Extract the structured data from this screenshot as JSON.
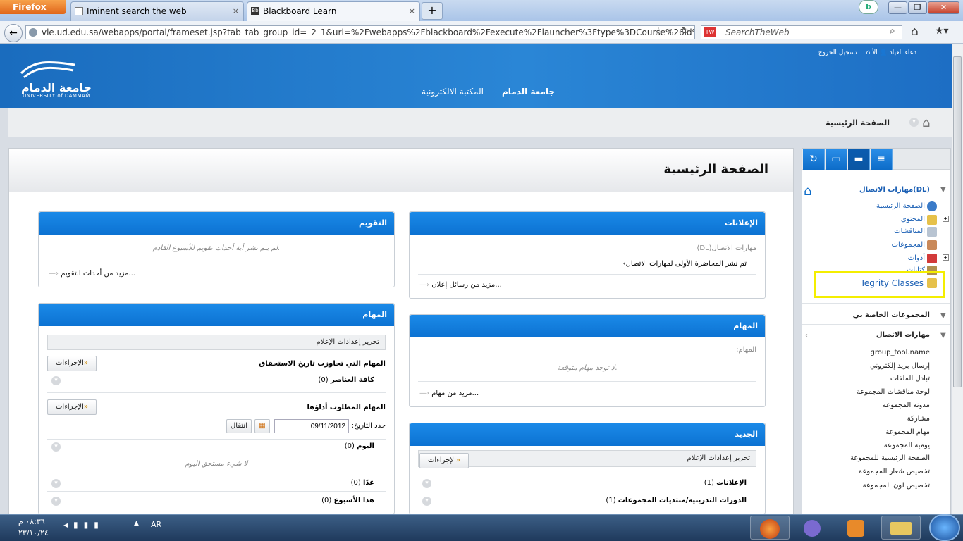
{
  "browser": {
    "firefox_label": "Firefox",
    "tabs": [
      {
        "label": "Iminent search the web",
        "close": "×"
      },
      {
        "label": "Blackboard Learn",
        "close": "×"
      }
    ],
    "new_tab": "+",
    "back": "←",
    "url": "vle.ud.edu.sa/webapps/portal/frameset.jsp?tab_tab_group_id=_2_1&url=%2Fwebapps%2Fblackboard%2Fexecute%2Flauncher%3Ftype%3DCourse%26id%3D_19658_",
    "search_placeholder": "SearchTheWeb",
    "search_engine_icon": "TW",
    "window_buttons": {
      "minimize": "—",
      "maximize": "❐",
      "close": "✕"
    }
  },
  "header": {
    "logo_ar": "جامعة الدمام",
    "logo_en": "UNIVERSITY of DAMMAM",
    "links": [
      "جامعة الدمام",
      "المكتبة الالكترونية"
    ],
    "user_name": "دعاء العياد",
    "user_extra": "الأ",
    "logout": "تسجيل الخروج"
  },
  "breadcrumb": {
    "label": "الصفحة الرئيسية"
  },
  "page": {
    "title": "الصفحة الرئيسية"
  },
  "modules": {
    "announcements": {
      "title": "الإعلانات",
      "course": "مهارات الاتصال(DL)",
      "item": "تم نشر المحاضرة الأولى لمهارات الاتصال",
      "more": "مزيد من رسائل إعلان..."
    },
    "calendar": {
      "title": "التقويم",
      "empty": "لم يتم نشر أية أحداث تقويم للأسبوع القادم.",
      "more": "مزيد من أحداث التقويم..."
    },
    "tasks": {
      "title": "المهام",
      "label": "المهام:",
      "empty": "لا توجد مهام متوقعة.",
      "more": "مزيد من مهام..."
    },
    "todo": {
      "title": "المهام",
      "edit_notifications": "تحرير إعدادات الإعلام",
      "overdue_label": "المهام التي تجاوزت تاريخ الاستحقاق",
      "actions": "الإجراءات",
      "all_items": "كافة العناصر",
      "all_items_count": "(0)",
      "due_label": "المهام المطلوب أداؤها",
      "date_label": "حدد التاريخ:",
      "date_value": "09/11/2012",
      "go_button": "انتقال",
      "today": "اليوم",
      "today_count": "(0)",
      "today_empty": "لا شيء مستحق اليوم",
      "tomorrow": "غدًا",
      "tomorrow_count": "(0)",
      "this_week": "هذا الأسبوع",
      "this_week_count": "(0)"
    },
    "whats_new": {
      "title": "الجديد",
      "edit_notifications": "تحرير إعدادات الإعلام",
      "actions": "الإجراءات",
      "announcements": "الإعلانات",
      "announcements_count": "(1)",
      "discussions": "الدورات التدريبية/منتديات المجموعات",
      "discussions_count": "(1)"
    }
  },
  "sidebar": {
    "tabs": [
      "↻",
      "▭",
      "▬",
      "≡"
    ],
    "course_title": "مهارات الاتصال(DL)",
    "menu": [
      {
        "label": "الصفحة الرئيسية",
        "icon": "globe-icon"
      },
      {
        "label": "المحتوى",
        "icon": "folder-icon"
      },
      {
        "label": "المناقشات",
        "icon": "discussion-icon"
      },
      {
        "label": "المجموعات",
        "icon": "groups-icon"
      },
      {
        "label": "أدوات",
        "icon": "tools-icon"
      },
      {
        "label": "كتابات",
        "icon": "notes-icon"
      },
      {
        "label": "Tegrity Classes",
        "icon": "folder-icon"
      }
    ],
    "groups_title": "المجموعات الخاصة بي",
    "group_course": "مهارات الاتصال",
    "group_links": [
      "group_tool.name",
      "إرسال بريد إلكتروني",
      "تبادل الملفات",
      "لوحة مناقشات المجموعة",
      "مدونة المجموعة",
      "مشاركة",
      "مهام المجموعة",
      "يومية المجموعة",
      "الصفحة الرئيسية للمجموعة",
      "تخصيص شعار المجموعة",
      "تخصيص لون المجموعة"
    ]
  },
  "taskbar": {
    "lang": "AR",
    "time": "٠٨:٣٦ م",
    "date": "٢٣/١٠/٢٤"
  }
}
